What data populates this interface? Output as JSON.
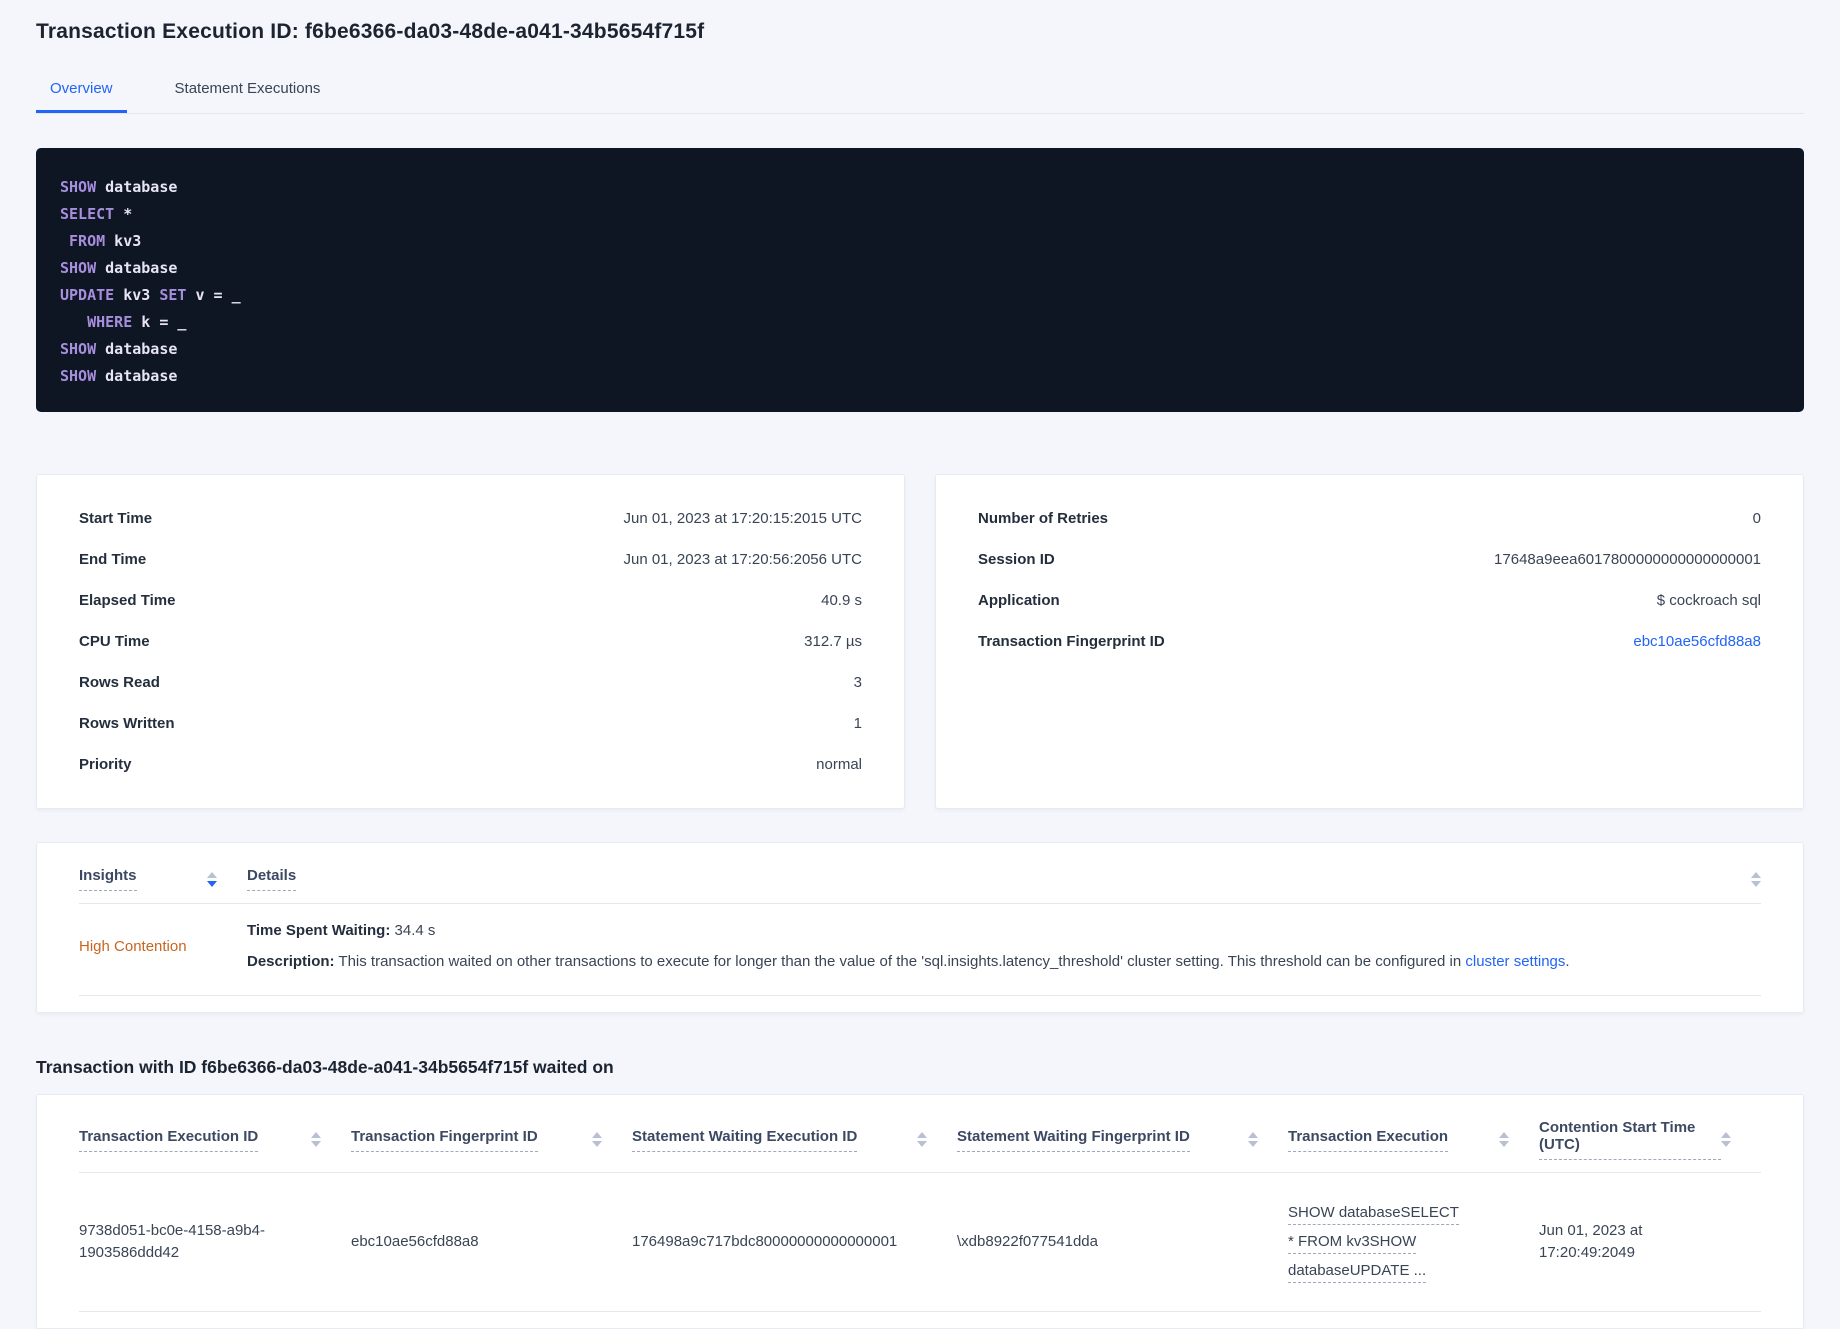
{
  "page": {
    "title": "Transaction Execution ID: f6be6366-da03-48de-a041-34b5654f715f"
  },
  "tabs": {
    "overview": "Overview",
    "statement_executions": "Statement Executions"
  },
  "sql": {
    "lines": [
      {
        "segs": [
          {
            "t": "SHOW"
          },
          {
            "t": " database"
          }
        ]
      },
      {
        "segs": [
          {
            "t": "SELECT"
          },
          {
            "t": " *"
          }
        ]
      },
      {
        "segs": [
          {
            "t": " "
          },
          {
            "t": "FROM"
          },
          {
            "t": " kv3"
          }
        ]
      },
      {
        "segs": [
          {
            "t": "SHOW"
          },
          {
            "t": " database"
          }
        ]
      },
      {
        "segs": [
          {
            "t": "UPDATE"
          },
          {
            "t": " kv3 "
          },
          {
            "t": "SET"
          },
          {
            "t": " v = _"
          }
        ]
      },
      {
        "segs": [
          {
            "t": "   "
          },
          {
            "t": "WHERE"
          },
          {
            "t": " k = _"
          }
        ]
      },
      {
        "segs": [
          {
            "t": "SHOW"
          },
          {
            "t": " database"
          }
        ]
      },
      {
        "segs": [
          {
            "t": "SHOW"
          },
          {
            "t": " database"
          }
        ]
      }
    ]
  },
  "summary_left": {
    "rows": [
      {
        "label": "Start Time",
        "value": "Jun 01, 2023 at 17:20:15:2015 UTC"
      },
      {
        "label": "End Time",
        "value": "Jun 01, 2023 at 17:20:56:2056 UTC"
      },
      {
        "label": "Elapsed Time",
        "value": "40.9 s"
      },
      {
        "label": "CPU Time",
        "value": "312.7 µs"
      },
      {
        "label": "Rows Read",
        "value": "3"
      },
      {
        "label": "Rows Written",
        "value": "1"
      },
      {
        "label": "Priority",
        "value": "normal"
      }
    ]
  },
  "summary_right": {
    "rows": [
      {
        "label": "Number of Retries",
        "value": "0"
      },
      {
        "label": "Session ID",
        "value": "17648a9eea6017800000000000000001"
      },
      {
        "label": "Application",
        "value": "$ cockroach sql"
      },
      {
        "label": "Transaction Fingerprint ID",
        "value": "ebc10ae56cfd88a8"
      }
    ]
  },
  "insights_table": {
    "columns": {
      "insights": "Insights",
      "details": "Details"
    },
    "row": {
      "insight": "High Contention",
      "waiting_label": "Time Spent Waiting:",
      "waiting_value": " 34.4 s",
      "description_label": "Description:",
      "description_text": " This transaction waited on other transactions to execute for longer than the value of the 'sql.insights.latency_threshold' cluster setting. This threshold can be configured in ",
      "description_link": "cluster settings",
      "description_suffix": "."
    }
  },
  "waited_section": {
    "title": "Transaction with ID f6be6366-da03-48de-a041-34b5654f715f waited on",
    "columns": [
      "Transaction Execution ID",
      "Transaction Fingerprint ID",
      "Statement Waiting Execution ID",
      "Statement Waiting Fingerprint ID",
      "Transaction Execution",
      "Contention Start Time (UTC)"
    ],
    "row": {
      "transaction_execution_id": "9738d051-bc0e-4158-a9b4-1903586ddd42",
      "transaction_fingerprint_id": "ebc10ae56cfd88a8",
      "statement_waiting_execution_id": "176498a9c717bdc80000000000000001",
      "statement_waiting_fingerprint_id": "\\xdb8922f077541dda",
      "transaction_execution": "SHOW databaseSELECT * FROM kv3SHOW databaseUPDATE ...",
      "contention_start_time": "Jun 01, 2023 at 17:20:49:2049"
    }
  },
  "colors": {
    "accent_blue": "#2264f6",
    "insight_orange": "#c8651f",
    "code_background": "#0e1523",
    "code_keyword": "#a78fdd",
    "code_plain": "#e7e4f6",
    "page_background": "#f4f6fb"
  }
}
